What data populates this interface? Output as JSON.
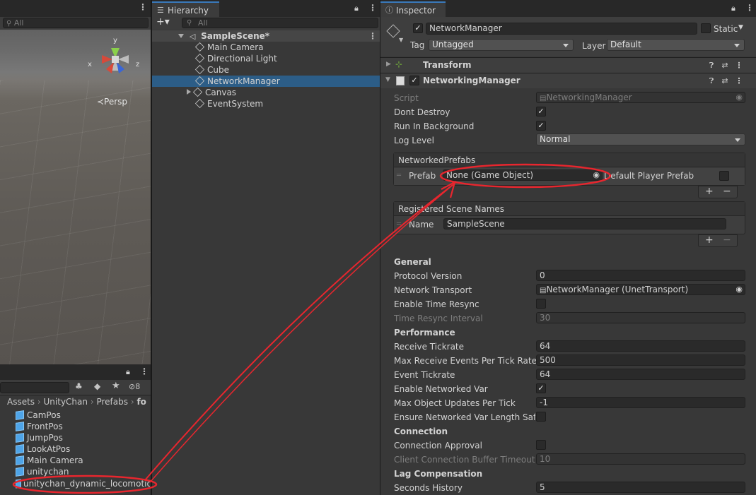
{
  "scene": {
    "search_placeholder": "All",
    "persp_label": "≺Persp",
    "gizmo_axes": [
      "x",
      "y",
      "z"
    ]
  },
  "project": {
    "search_value": "",
    "hidden_count": "8",
    "breadcrumb": [
      "Assets",
      "UnityChan",
      "Prefabs",
      "fo"
    ],
    "assets": [
      "CamPos",
      "FrontPos",
      "JumpPos",
      "LookAtPos",
      "Main Camera",
      "unitychan",
      "unitychan_dynamic_locomotion"
    ]
  },
  "hierarchy": {
    "tab_label": "Hierarchy",
    "add_label": "+▾",
    "search_placeholder": "All",
    "scene_name": "SampleScene*",
    "items": [
      {
        "label": "Main Camera"
      },
      {
        "label": "Directional Light"
      },
      {
        "label": "Cube"
      },
      {
        "label": "NetworkManager"
      },
      {
        "label": "Canvas"
      },
      {
        "label": "EventSystem"
      }
    ]
  },
  "inspector": {
    "tab_label": "Inspector",
    "object_name": "NetworkManager",
    "static_label": "Static",
    "tag_label": "Tag",
    "tag_value": "Untagged",
    "layer_label": "Layer",
    "layer_value": "Default",
    "transform_title": "Transform",
    "component_title": "NetworkingManager",
    "script_label": "Script",
    "script_value": "NetworkingManager",
    "dont_destroy_label": "Dont Destroy",
    "run_bg_label": "Run In Background",
    "log_level_label": "Log Level",
    "log_level_value": "Normal",
    "networked_prefabs": {
      "title": "NetworkedPrefabs",
      "prefab_label": "Prefab",
      "prefab_value": "None (Game Object)",
      "default_player_label": "Default Player Prefab",
      "plus": "+",
      "minus": "−"
    },
    "scene_names": {
      "title": "Registered Scene Names",
      "name_label": "Name",
      "name_value": "SampleScene",
      "plus": "+",
      "minus": "−"
    },
    "general_header": "General",
    "protocol_version_label": "Protocol Version",
    "protocol_version_value": "0",
    "network_transport_label": "Network Transport",
    "network_transport_value": "NetworkManager (UnetTransport)",
    "enable_time_resync_label": "Enable Time Resync",
    "time_resync_interval_label": "Time Resync Interval",
    "time_resync_interval_value": "30",
    "performance_header": "Performance",
    "receive_tickrate_label": "Receive Tickrate",
    "receive_tickrate_value": "64",
    "max_receive_label": "Max Receive Events Per Tick Rate",
    "max_receive_value": "500",
    "event_tickrate_label": "Event Tickrate",
    "event_tickrate_value": "64",
    "enable_networked_var_label": "Enable Networked Var",
    "max_object_updates_label": "Max Object Updates Per Tick",
    "max_object_updates_value": "-1",
    "ensure_length_label": "Ensure Networked Var Length Safet",
    "connection_header": "Connection",
    "connection_approval_label": "Connection Approval",
    "client_buffer_label": "Client Connection Buffer Timeout",
    "client_buffer_value": "10",
    "lag_header": "Lag Compensation",
    "seconds_history_label": "Seconds History",
    "seconds_history_value": "5",
    "checkmark": "✓"
  },
  "colors": {
    "annotation_red": "#e8262e",
    "selection_blue": "#2c5d87",
    "tab_accent": "#3a79bb"
  }
}
